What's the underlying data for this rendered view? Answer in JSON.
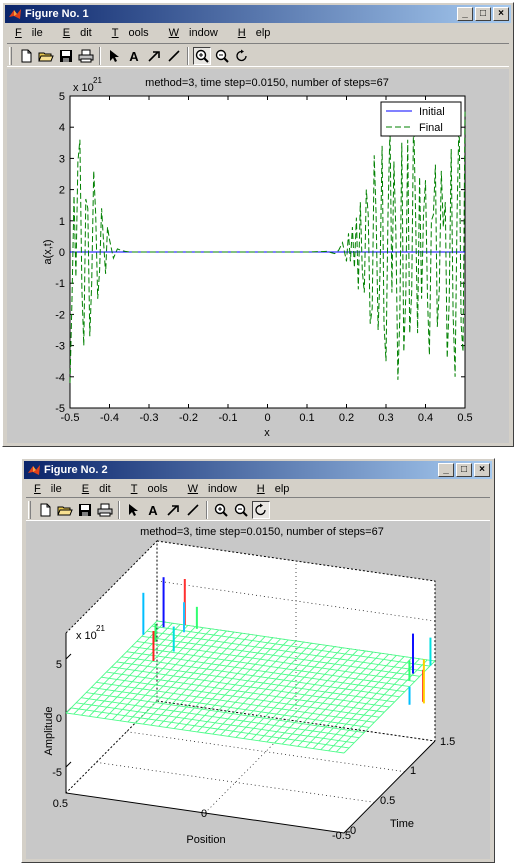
{
  "menu": [
    {
      "mnemonic": "F",
      "rest": "ile"
    },
    {
      "mnemonic": "E",
      "rest": "dit"
    },
    {
      "mnemonic": "T",
      "rest": "ools"
    },
    {
      "mnemonic": "W",
      "rest": "indow"
    },
    {
      "mnemonic": "H",
      "rest": "elp"
    }
  ],
  "toolbar_icons": [
    "new-figure-icon",
    "open-file-icon",
    "save-icon",
    "print-icon",
    "select-arrow-icon",
    "insert-text-icon",
    "insert-arrow-icon",
    "insert-line-icon",
    "zoom-in-icon",
    "zoom-out-icon",
    "rotate-3d-icon"
  ],
  "window_buttons": {
    "minimize": "_",
    "maximize": "□",
    "close": "×"
  },
  "figure1": {
    "title": "Figure No. 1",
    "toolbar_pressed": "zoom-in-icon",
    "chart_data": {
      "type": "line",
      "title": "method=3, time step=0.0150, number of steps=67",
      "xlabel": "x",
      "ylabel": "a(x,t)",
      "y_exponent": "x 10",
      "y_exponent_power": "21",
      "xlim": [
        -0.5,
        0.5
      ],
      "ylim": [
        -5,
        5
      ],
      "xticks": [
        "-0.5",
        "-0.4",
        "-0.3",
        "-0.2",
        "-0.1",
        "0",
        "0.1",
        "0.2",
        "0.3",
        "0.4",
        "0.5"
      ],
      "yticks": [
        "5",
        "4",
        "3",
        "2",
        "1",
        "0",
        "-1",
        "-2",
        "-3",
        "-4",
        "-5"
      ],
      "grid": false,
      "legend_position": "top-right",
      "series": [
        {
          "name": "Initial",
          "color": "#0000ff",
          "style": "solid",
          "x": [
            -0.5,
            0.5
          ],
          "y": [
            0,
            0
          ]
        },
        {
          "name": "Final",
          "color": "#008000",
          "style": "dashed",
          "x": [
            -0.5,
            -0.495,
            -0.49,
            -0.485,
            -0.48,
            -0.475,
            -0.47,
            -0.465,
            -0.46,
            -0.455,
            -0.45,
            -0.445,
            -0.44,
            -0.435,
            -0.43,
            -0.425,
            -0.42,
            -0.415,
            -0.41,
            -0.405,
            -0.4,
            -0.39,
            -0.38,
            -0.37,
            -0.36,
            -0.35,
            -0.3,
            -0.2,
            -0.1,
            0.0,
            0.1,
            0.15,
            0.17,
            0.18,
            0.19,
            0.2,
            0.205,
            0.21,
            0.215,
            0.22,
            0.225,
            0.23,
            0.235,
            0.24,
            0.245,
            0.25,
            0.255,
            0.26,
            0.265,
            0.27,
            0.275,
            0.28,
            0.285,
            0.29,
            0.295,
            0.3,
            0.305,
            0.31,
            0.315,
            0.32,
            0.325,
            0.33,
            0.335,
            0.34,
            0.345,
            0.35,
            0.355,
            0.36,
            0.365,
            0.37,
            0.375,
            0.38,
            0.385,
            0.39,
            0.395,
            0.4,
            0.405,
            0.41,
            0.415,
            0.42,
            0.425,
            0.43,
            0.435,
            0.44,
            0.445,
            0.45,
            0.455,
            0.46,
            0.465,
            0.47,
            0.475,
            0.48,
            0.485,
            0.49,
            0.495,
            0.5
          ],
          "y": [
            -4.2,
            -1.5,
            1.8,
            -0.8,
            2.9,
            3.6,
            -1.2,
            -3.0,
            1.7,
            1.4,
            -2.7,
            -1.0,
            2.6,
            1.2,
            -1.5,
            -0.6,
            1.4,
            0.3,
            -0.7,
            0.8,
            0.4,
            -0.2,
            0.1,
            0.05,
            0.02,
            0.0,
            0.0,
            0.0,
            0.0,
            0.0,
            0.0,
            0.02,
            -0.05,
            0.05,
            0.3,
            -0.3,
            0.6,
            -0.3,
            0.8,
            -0.5,
            1.1,
            -1.2,
            1.6,
            -0.6,
            -1.3,
            2.0,
            1.2,
            -2.3,
            -1.8,
            3.1,
            1.2,
            -2.5,
            -0.6,
            3.4,
            -2.3,
            -3.5,
            1.2,
            4.0,
            -1.3,
            2.9,
            0.6,
            -4.1,
            -2.1,
            3.5,
            -3.2,
            -1.4,
            3.6,
            -2.6,
            -1.3,
            4.4,
            1.2,
            -2.6,
            2.4,
            -1.5,
            1.2,
            2.3,
            -1.5,
            -3.3,
            1.0,
            1.2,
            2.8,
            -2.4,
            -1.2,
            2.6,
            0.8,
            1.6,
            -3.4,
            -1.6,
            3.3,
            -2.0,
            -4.0,
            1.3,
            4.4,
            -2.3,
            -3.2,
            4.5
          ]
        }
      ]
    }
  },
  "figure2": {
    "title": "Figure No. 2",
    "toolbar_pressed": "rotate-3d-icon",
    "chart_data": {
      "type": "surface",
      "title": "method=3, time step=0.0150, number of steps=67",
      "xlabel": "Position",
      "ylabel": "Time",
      "zlabel": "Amplitude",
      "z_exponent": "x 10",
      "z_exponent_power": "21",
      "position_ticks": [
        "0.5",
        "0",
        "-0.5"
      ],
      "time_ticks": [
        "0",
        "0.5",
        "1",
        "1.5"
      ],
      "amplitude_ticks": [
        "5",
        "0",
        "-5"
      ],
      "position_range": [
        -0.5,
        0.5
      ],
      "time_range": [
        0,
        1.5
      ],
      "amplitude_range": [
        -5,
        5
      ],
      "grid": true
    }
  }
}
